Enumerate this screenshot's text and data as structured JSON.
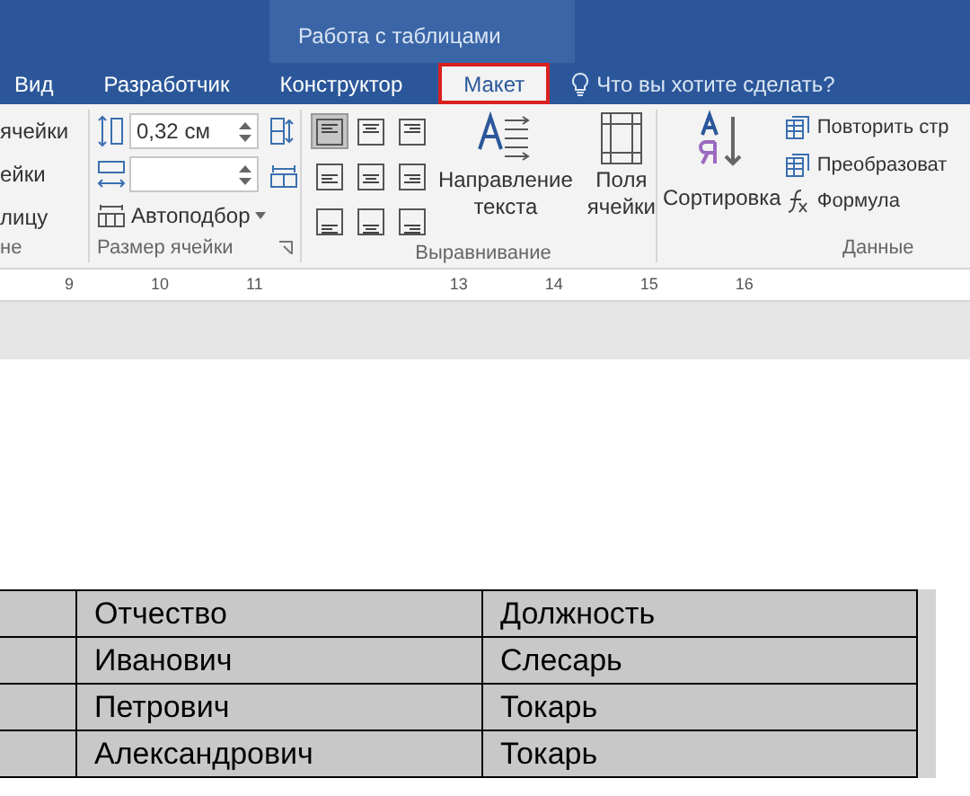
{
  "contextual_title": "Работа с таблицами",
  "tabs": [
    {
      "label": "Вид",
      "selected": false
    },
    {
      "label": "Разработчик",
      "selected": false
    },
    {
      "label": "Конструктор",
      "selected": false
    },
    {
      "label": "Макет",
      "selected": true
    }
  ],
  "tell_me": {
    "placeholder": "Что вы хотите сделать?"
  },
  "ribbon": {
    "cut_group": {
      "items": [
        "ячейки",
        "ейки",
        "лицу"
      ],
      "label": "не"
    },
    "cell_size": {
      "height_value": "0,32 см",
      "autofit": "Автоподбор",
      "label": "Размер ячейки"
    },
    "alignment": {
      "buttons": [
        {
          "selected": true
        },
        {
          "selected": false
        },
        {
          "selected": false
        },
        {
          "selected": false
        },
        {
          "selected": false
        },
        {
          "selected": false
        },
        {
          "selected": false
        },
        {
          "selected": false
        },
        {
          "selected": false
        }
      ],
      "text_direction": [
        "Направление",
        "текста"
      ],
      "margins": [
        "Поля",
        "ячейки"
      ],
      "label": "Выравнивание"
    },
    "data": {
      "sort": "Сортировка",
      "items": [
        "Повторить стр",
        "Преобразоват",
        "Формула"
      ],
      "label": "Данные"
    }
  },
  "ruler": [
    "9",
    "10",
    "11",
    "13",
    "14",
    "15",
    "16"
  ],
  "table": {
    "rows": [
      [
        "Отчество",
        "Должность"
      ],
      [
        "Иванович",
        "Слесарь"
      ],
      [
        "Петрович",
        "Токарь"
      ],
      [
        "Александрович",
        "Токарь"
      ]
    ]
  }
}
